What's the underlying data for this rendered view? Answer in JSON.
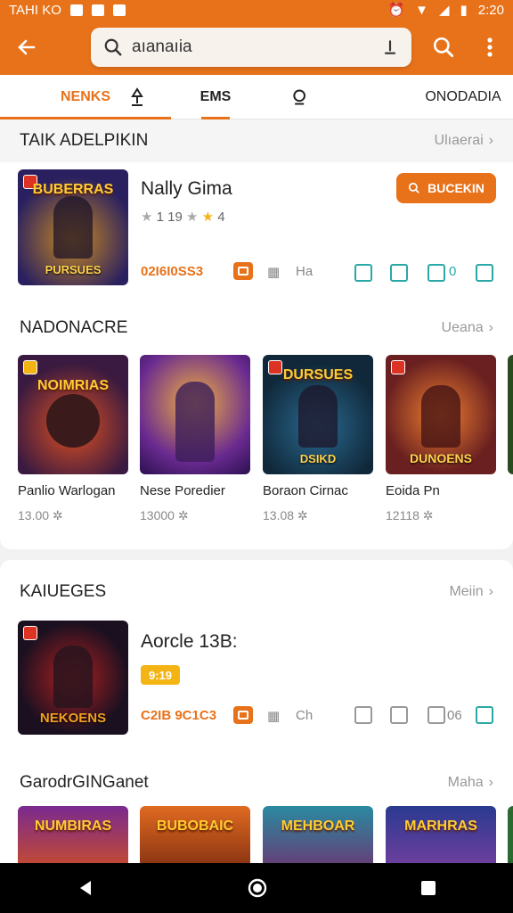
{
  "status_bar": {
    "carrier": "TAHI KO",
    "time": "2:20"
  },
  "search": {
    "value": "aıanaıia"
  },
  "tabs": [
    {
      "label": "NENKS"
    },
    {
      "label": ""
    },
    {
      "label": "EMS"
    },
    {
      "label": ""
    },
    {
      "label": "ONODADIA"
    }
  ],
  "section1": {
    "title": "TAIK ADELPIKIN",
    "more": "Ulıaerai",
    "featured": {
      "cover_text": "BUBERRAS",
      "cover_caption": "PURSUES",
      "title": "Nally Gima",
      "rating": "1 19",
      "rating_suffix": "4",
      "button_label": "BUCEKIN",
      "count": "02I6I0SS3",
      "extra": "Ha",
      "extra2": "0"
    }
  },
  "section2": {
    "title": "NADONACRE",
    "more": "Ueana",
    "items": [
      {
        "cover_text": "NOIMRIAS",
        "name": "Panlio Warlogan",
        "meta": "13.00 ✲"
      },
      {
        "cover_text": "",
        "name": "Nese Poredier",
        "meta": "13000 ✲"
      },
      {
        "cover_text": "DURSUES",
        "cover_caption": "DSIKD",
        "name": "Boraon Cirnac",
        "meta": "13.08 ✲"
      },
      {
        "cover_text": "",
        "cover_caption": "DUNOENS",
        "name": "Eoida Pn",
        "meta": "12118 ✲"
      }
    ]
  },
  "section3": {
    "title": "KAIUEGES",
    "more": "Meiin",
    "featured": {
      "cover_caption": "NEKOENS",
      "title": "Aorcle 13B:",
      "tag": "9:19",
      "count": "C2IB 9C1C3",
      "extra": "Ch",
      "extra2": "06"
    }
  },
  "section4": {
    "title": "GarodrGINGanet",
    "more": "Maha",
    "items": [
      {
        "cover_text": "NUMBIRAS"
      },
      {
        "cover_text": "BUBOBAIC"
      },
      {
        "cover_text": "MEHBOAR"
      },
      {
        "cover_text": "MARHRAS"
      }
    ]
  }
}
